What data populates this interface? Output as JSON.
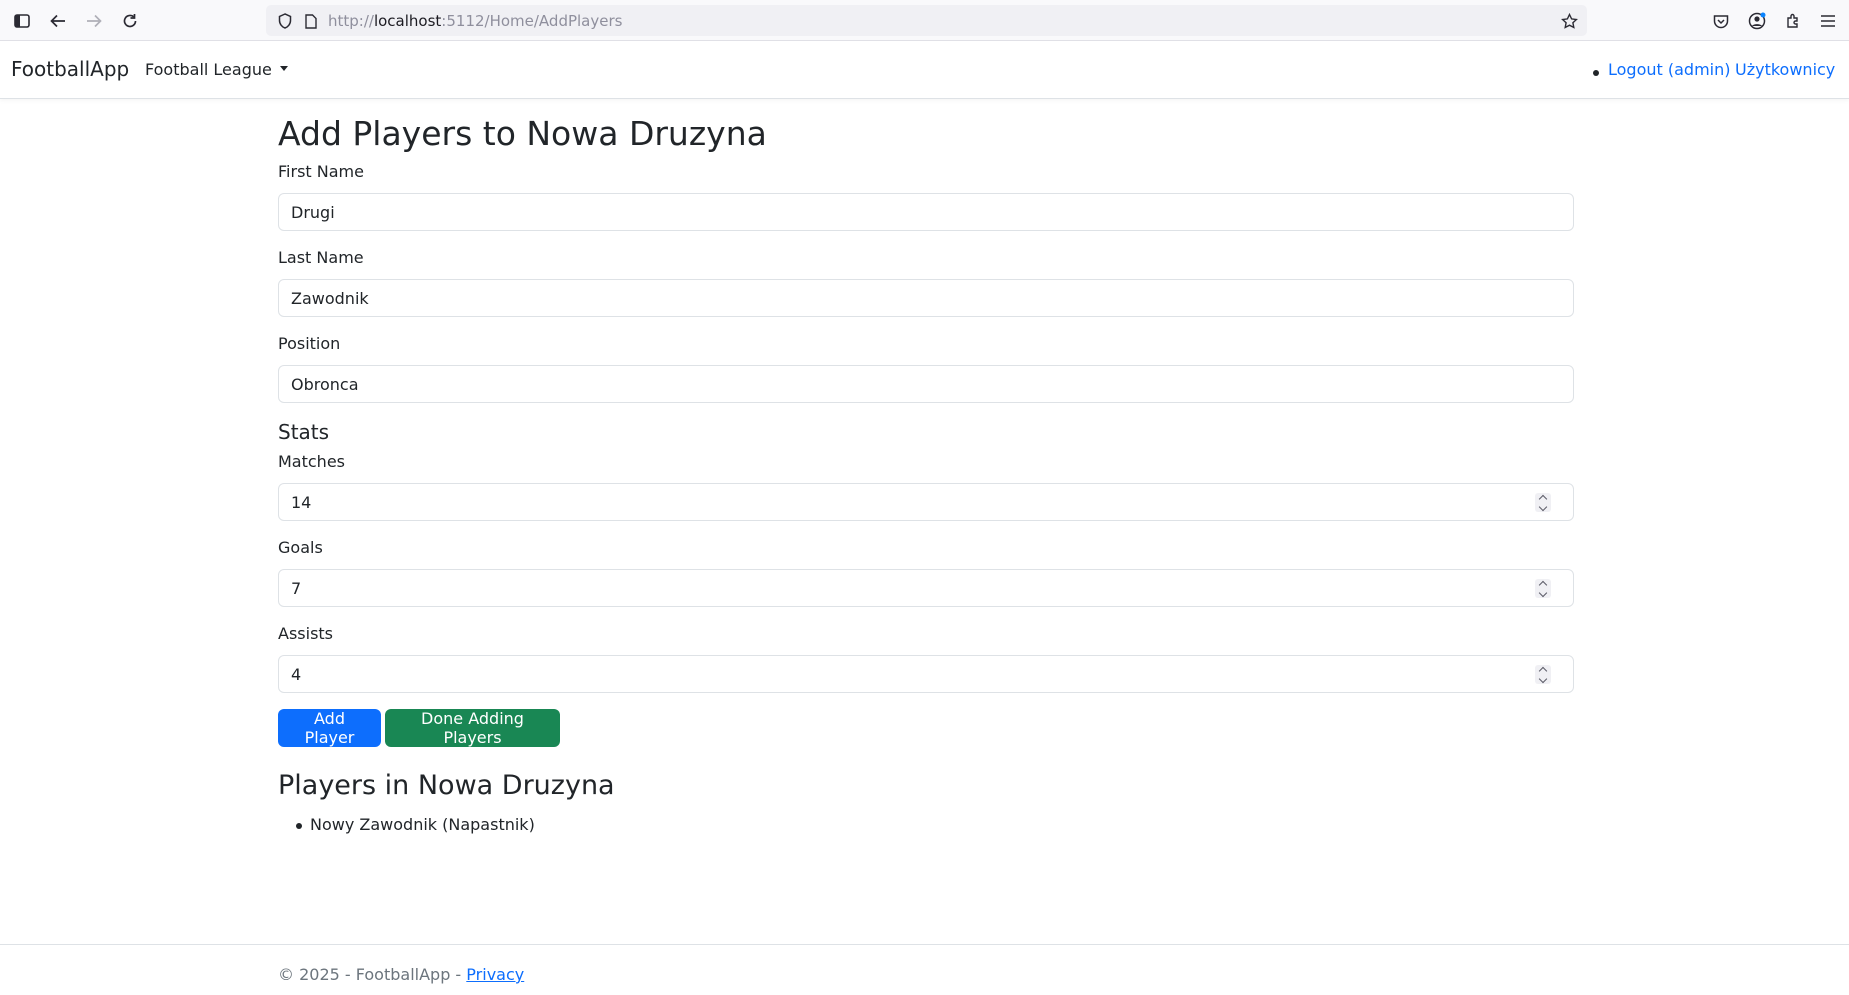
{
  "browser": {
    "url_scheme": "http://",
    "url_host": "localhost",
    "url_path": ":5112/Home/AddPlayers",
    "icons": [
      "sidebar-icon",
      "back-icon",
      "forward-icon",
      "reload-icon",
      "shield-icon",
      "page-icon",
      "bookmark-star-icon",
      "pocket-icon",
      "account-icon",
      "extensions-icon",
      "menu-icon"
    ]
  },
  "navbar": {
    "brand": "FootballApp",
    "dropdown_label": "Football League",
    "logout_label": "Logout (admin)",
    "users_label": "Użytkownicy"
  },
  "form": {
    "title": "Add Players to Nowa Druzyna",
    "first_name": {
      "label": "First Name",
      "value": "Drugi"
    },
    "last_name": {
      "label": "Last Name",
      "value": "Zawodnik"
    },
    "position": {
      "label": "Position",
      "value": "Obronca"
    },
    "stats_heading": "Stats",
    "matches": {
      "label": "Matches",
      "value": "14"
    },
    "goals": {
      "label": "Goals",
      "value": "7"
    },
    "assists": {
      "label": "Assists",
      "value": "4"
    },
    "add_button": "Add Player",
    "done_button": "Done Adding Players"
  },
  "players": {
    "title": "Players in Nowa Druzyna",
    "items": [
      "Nowy Zawodnik (Napastnik)"
    ]
  },
  "footer": {
    "text": "© 2025 - FootballApp - ",
    "privacy_link": "Privacy"
  },
  "colors": {
    "primary": "#0d6efd",
    "success": "#198754",
    "text": "#212529",
    "muted": "#6c757d"
  }
}
